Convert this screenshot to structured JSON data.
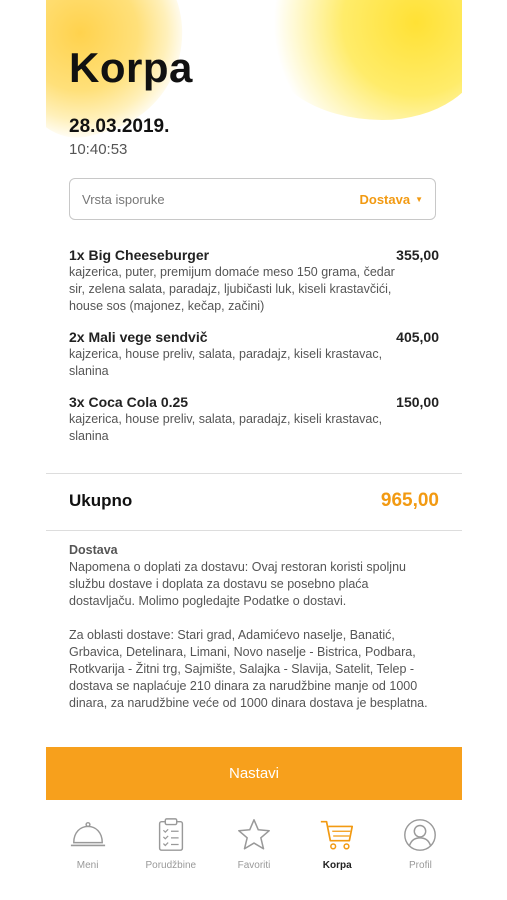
{
  "header": {
    "title": "Korpa",
    "date": "28.03.2019.",
    "time": "10:40:53"
  },
  "delivery": {
    "placeholder": "Vrsta isporuke",
    "selected": "Dostava"
  },
  "items": [
    {
      "name": "1x Big Cheeseburger",
      "price": "355,00",
      "description": "kajzerica, puter, premijum domaće meso 150 grama, čedar sir, zelena salata, paradajz, ljubičasti luk, kiseli krastavčići, house sos (majonez, kečap, začini)"
    },
    {
      "name": "2x Mali vege sendvič",
      "price": "405,00",
      "description": "kajzerica, house preliv, salata, paradajz, kiseli krastavac, slanina"
    },
    {
      "name": "3x Coca Cola 0.25",
      "price": "150,00",
      "description": "kajzerica, house preliv, salata, paradajz, kiseli krastavac, slanina"
    }
  ],
  "total": {
    "label": "Ukupno",
    "value": "965,00"
  },
  "notes": {
    "heading": "Dostava",
    "p1": "Napomena o doplati za dostavu: Ovaj restoran koristi spoljnu službu dostave i doplata za dostavu se posebno plaća dostavljaču. Molimo pogledajte Podatke o dostavi.",
    "p2": "Za oblasti dostave: Stari grad, Adamićevo naselje, Banatić, Grbavica, Detelinara, Limani, Novo naselje - Bistrica, Podbara, Rotkvarija - Žitni trg, Sajmište, Salajka - Slavija, Satelit, Telep - dostava se naplaćuje 210 dinara za narudžbine manje od 1000 dinara, za narudžbine veće od 1000 dinara dostava je besplatna."
  },
  "cta": {
    "label": "Nastavi"
  },
  "tabs": [
    {
      "label": "Meni",
      "icon": "cloche-icon"
    },
    {
      "label": "Porudžbine",
      "icon": "clipboard-icon"
    },
    {
      "label": "Favoriti",
      "icon": "star-icon"
    },
    {
      "label": "Korpa",
      "icon": "cart-icon",
      "active": true
    },
    {
      "label": "Profil",
      "icon": "profile-icon"
    }
  ],
  "colors": {
    "accent": "#f7a01c",
    "accent_text": "#f29a12"
  }
}
